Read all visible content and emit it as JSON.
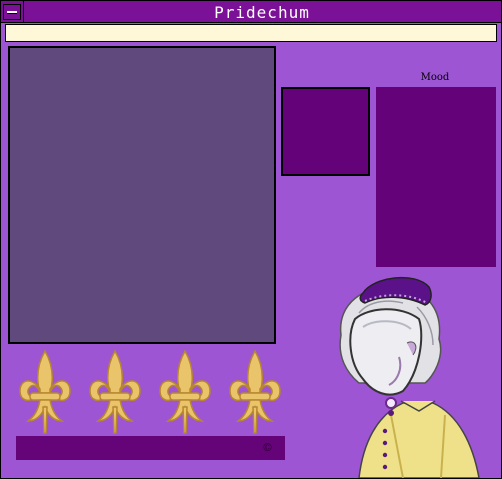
{
  "window": {
    "title": "Pridechum",
    "system_menu_icon": "window-menu-icon"
  },
  "panels": {
    "mood_label": "Mood",
    "status_symbol": "©"
  },
  "decorations": {
    "fleur_count": 4,
    "fleur_icon": "fleur-de-lis-icon"
  },
  "colors": {
    "window_bg": "#9d55d4",
    "titlebar": "#7b1196",
    "menubar": "#fff8d8",
    "main_panel": "#604a7d",
    "dark_panel": "#630279",
    "fleur_gold": "#e8c060"
  }
}
